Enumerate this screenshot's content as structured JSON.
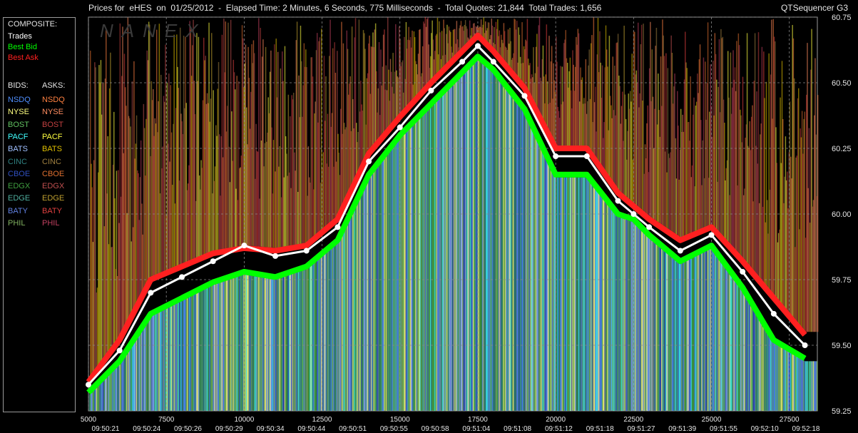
{
  "header": {
    "title": "Prices for  eHES  on  01/25/2012  -  Elapsed Time: 2 Minutes, 6 Seconds, 775 Milliseconds  -  Total Quotes: 21,844  Total Trades: 1,656",
    "app_name": "QTSequencer G3"
  },
  "legend": {
    "composite_label": "COMPOSITE:",
    "composite_items": [
      {
        "label": "Trades",
        "color": "#ffffff"
      },
      {
        "label": "Best Bid",
        "color": "#00ff00"
      },
      {
        "label": "Best Ask",
        "color": "#ff2020"
      }
    ],
    "bids_label": "BIDS:",
    "asks_label": "ASKS:",
    "exchanges": [
      {
        "bid": "NSDQ",
        "ask": "NSDQ",
        "bid_color": "#4f8fff",
        "ask_color": "#ff8040"
      },
      {
        "bid": "NYSE",
        "ask": "NYSE",
        "bid_color": "#ffff80",
        "ask_color": "#ff8c60"
      },
      {
        "bid": "BOST",
        "ask": "BOST",
        "bid_color": "#60c060",
        "ask_color": "#c04040"
      },
      {
        "bid": "PACF",
        "ask": "PACF",
        "bid_color": "#40ffff",
        "ask_color": "#ffff40"
      },
      {
        "bid": "BATS",
        "ask": "BATS",
        "bid_color": "#a0c0ff",
        "ask_color": "#e0c000"
      },
      {
        "bid": "CINC",
        "ask": "CINC",
        "bid_color": "#308080",
        "ask_color": "#a08040"
      },
      {
        "bid": "CBOE",
        "ask": "CBOE",
        "bid_color": "#3050c0",
        "ask_color": "#e07030"
      },
      {
        "bid": "EDGX",
        "ask": "EDGX",
        "bid_color": "#40a040",
        "ask_color": "#c05050"
      },
      {
        "bid": "EDGE",
        "ask": "EDGE",
        "bid_color": "#50b0a0",
        "ask_color": "#c0a030"
      },
      {
        "bid": "BATY",
        "ask": "BATY",
        "bid_color": "#6080e0",
        "ask_color": "#e04040"
      },
      {
        "bid": "PHIL",
        "ask": "PHIL",
        "bid_color": "#80b060",
        "ask_color": "#c04060"
      }
    ]
  },
  "chart_data": {
    "type": "line",
    "title": "Prices for  eHES  on  01/25/2012",
    "xlabel": "",
    "ylabel": "",
    "ylim": [
      59.25,
      60.75
    ],
    "xlim": [
      5000,
      28400
    ],
    "y_ticks": [
      "59.25",
      "59.50",
      "59.75",
      "60.00",
      "60.25",
      "60.50",
      "60.75"
    ],
    "x_ticks": [
      "5000",
      "7500",
      "10000",
      "12500",
      "15000",
      "17500",
      "20000",
      "22500",
      "25000",
      "27500"
    ],
    "time_ticks": [
      "09:50:21",
      "09:50:24",
      "09:50:26",
      "09:50:29",
      "09:50:34",
      "09:50:44",
      "09:50:51",
      "09:50:55",
      "09:50:58",
      "09:51:04",
      "09:51:08",
      "09:51:12",
      "09:51:18",
      "09:51:27",
      "09:51:39",
      "09:51:55",
      "09:52:10",
      "09:52:18"
    ],
    "grid": true,
    "watermark": "NANEX",
    "series": [
      {
        "name": "Trades",
        "color": "#ffffff",
        "x": [
          5000,
          6000,
          7000,
          8000,
          9000,
          10000,
          11000,
          12000,
          13000,
          14000,
          15000,
          16000,
          17000,
          17500,
          18000,
          19000,
          20000,
          21000,
          22000,
          22500,
          23000,
          24000,
          25000,
          26000,
          27000,
          28000
        ],
        "y": [
          59.35,
          59.48,
          59.7,
          59.76,
          59.82,
          59.88,
          59.84,
          59.86,
          59.95,
          60.2,
          60.33,
          60.47,
          60.58,
          60.64,
          60.58,
          60.45,
          60.22,
          60.22,
          60.05,
          60.0,
          59.95,
          59.86,
          59.92,
          59.78,
          59.62,
          59.5
        ]
      },
      {
        "name": "Best Bid",
        "color": "#00ff00",
        "x": [
          5000,
          6000,
          7000,
          8000,
          9000,
          10000,
          11000,
          12000,
          13000,
          14000,
          15000,
          16000,
          17000,
          17500,
          18000,
          19000,
          20000,
          21000,
          22000,
          22500,
          23000,
          24000,
          25000,
          26000,
          27000,
          28000
        ],
        "y": [
          59.32,
          59.44,
          59.62,
          59.68,
          59.74,
          59.78,
          59.76,
          59.8,
          59.9,
          60.15,
          60.3,
          60.42,
          60.54,
          60.6,
          60.55,
          60.4,
          60.15,
          60.15,
          60.0,
          59.98,
          59.92,
          59.82,
          59.88,
          59.72,
          59.52,
          59.45
        ]
      },
      {
        "name": "Best Ask",
        "color": "#ff2020",
        "x": [
          5000,
          6000,
          7000,
          8000,
          9000,
          10000,
          11000,
          12000,
          13000,
          14000,
          15000,
          16000,
          17000,
          17500,
          18000,
          19000,
          20000,
          21000,
          22000,
          22500,
          23000,
          24000,
          25000,
          26000,
          27000,
          28000
        ],
        "y": [
          59.36,
          59.52,
          59.75,
          59.8,
          59.85,
          59.87,
          59.86,
          59.88,
          59.98,
          60.23,
          60.37,
          60.5,
          60.62,
          60.68,
          60.62,
          60.48,
          60.25,
          60.25,
          60.08,
          60.03,
          59.98,
          59.9,
          59.95,
          59.82,
          59.68,
          59.54
        ]
      }
    ]
  }
}
